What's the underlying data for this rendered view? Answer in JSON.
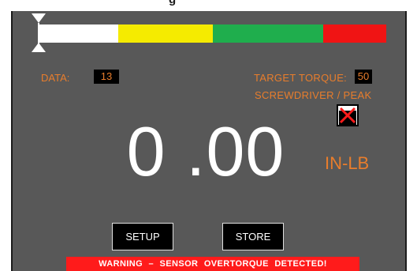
{
  "window": {
    "title_fragment": "g"
  },
  "torque_bar": {
    "segments": [
      {
        "name": "white",
        "color": "#ffffff",
        "fraction": 0.227
      },
      {
        "name": "yellow",
        "color": "#f5eb00",
        "fraction": 0.273
      },
      {
        "name": "green",
        "color": "#1fae4d",
        "fraction": 0.318
      },
      {
        "name": "red",
        "color": "#f01414",
        "fraction": 0.182
      }
    ],
    "marker_position": 0.0
  },
  "data_field": {
    "label": "DATA:",
    "value": "13"
  },
  "target_torque": {
    "label": "TARGET TORQUE:",
    "value": "50"
  },
  "mode": {
    "label": "SCREWDRIVER / PEAK"
  },
  "reading": {
    "value": "0 .00",
    "units": "IN-LB"
  },
  "buttons": {
    "setup": "SETUP",
    "store": "STORE"
  },
  "warning": {
    "text": "WARNING  –  SENSOR  OVERTORQUE  DETECTED!"
  },
  "colors": {
    "panel": "#585858",
    "accent_orange": "#e87d2c",
    "warning_red": "#ff1b1b"
  }
}
